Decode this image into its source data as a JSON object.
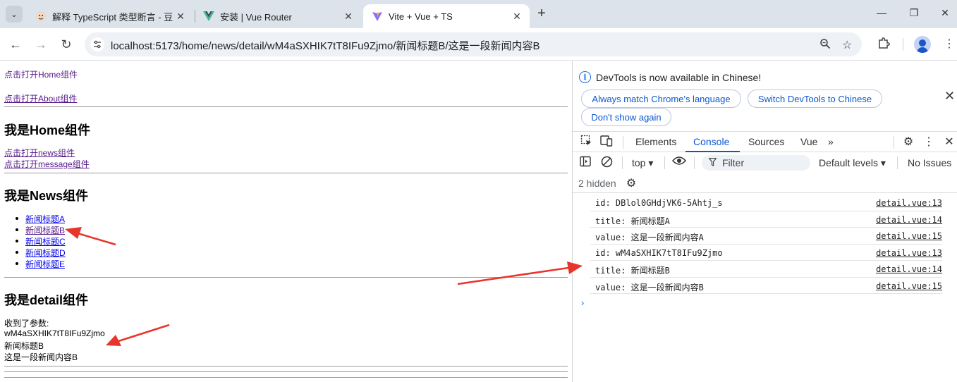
{
  "browser": {
    "tabs": [
      {
        "title": "解释 TypeScript 类型断言 - 豆",
        "active": false
      },
      {
        "title": "安装 | Vue Router",
        "active": false
      },
      {
        "title": "Vite + Vue + TS",
        "active": true
      }
    ],
    "new_tab": "+",
    "address": "localhost:5173/home/news/detail/wM4aSXHIK7tT8IFu9Zjmo/新闻标题B/这是一段新闻内容B"
  },
  "page": {
    "home_link": "点击打开Home组件",
    "about_link": "点击打开About组件",
    "home_heading": "我是Home组件",
    "news_link": "点击打开news组件",
    "message_link": "点击打开message组件",
    "news_heading": "我是News组件",
    "news_items": [
      "新闻标题A",
      "新闻标题B",
      "新闻标题C",
      "新闻标题D",
      "新闻标题E"
    ],
    "detail_heading": "我是detail组件",
    "received_label": "收到了参数:",
    "param_id": "wM4aSXHIK7tT8IFu9Zjmo",
    "param_title": "新闻标题B",
    "param_content": "这是一段新闻内容B"
  },
  "devtools": {
    "banner_text": "DevTools is now available in Chinese!",
    "btn_match": "Always match Chrome's language",
    "btn_switch": "Switch DevTools to Chinese",
    "btn_dont_show": "Don't show again",
    "tabs": [
      "Elements",
      "Console",
      "Sources",
      "Vue"
    ],
    "active_tab": "Console",
    "context": "top ▾",
    "filter_placeholder": "Filter",
    "levels": "Default levels ▾",
    "issues": "No Issues",
    "hidden_count": "2 hidden",
    "logs": [
      {
        "msg": "id: DBlol0GHdjVK6-5Ahtj_s",
        "src": "detail.vue:13"
      },
      {
        "msg": "title: 新闻标题A",
        "src": "detail.vue:14"
      },
      {
        "msg": "value: 这是一段新闻内容A",
        "src": "detail.vue:15"
      },
      {
        "msg": "id: wM4aSXHIK7tT8IFu9Zjmo",
        "src": "detail.vue:13"
      },
      {
        "msg": "title: 新闻标题B",
        "src": "detail.vue:14"
      },
      {
        "msg": "value: 这是一段新闻内容B",
        "src": "detail.vue:15"
      }
    ],
    "prompt": "›"
  },
  "colors": {
    "annotation_arrow": "#e8352b",
    "home_heading": "#008000",
    "accent": "#0b57d0"
  }
}
